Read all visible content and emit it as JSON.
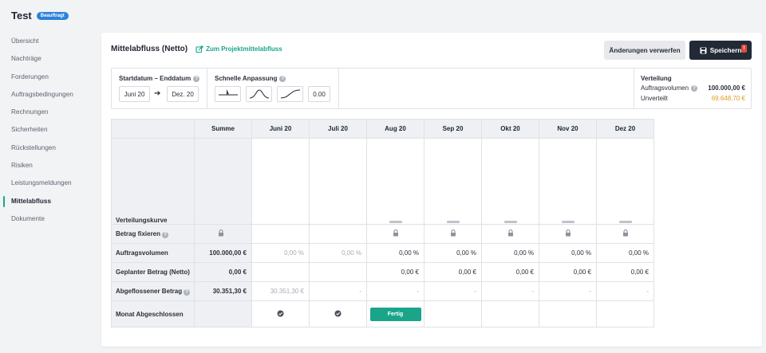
{
  "app": {
    "title": "Test",
    "badge": "Beauftragt"
  },
  "sidebar": {
    "items": [
      {
        "label": "Übersicht",
        "active": false
      },
      {
        "label": "Nachträge",
        "active": false
      },
      {
        "label": "Forderungen",
        "active": false
      },
      {
        "label": "Auftragsbedingungen",
        "active": false
      },
      {
        "label": "Rechnungen",
        "active": false
      },
      {
        "label": "Sicherheiten",
        "active": false
      },
      {
        "label": "Rückstellungen",
        "active": false
      },
      {
        "label": "Risiken",
        "active": false
      },
      {
        "label": "Leistungsmeldungen",
        "active": false
      },
      {
        "label": "Mittelabfluss",
        "active": true
      },
      {
        "label": "Dokumente",
        "active": false
      }
    ]
  },
  "header": {
    "title": "Mittelabfluss (Netto)",
    "link_label": "Zum Projektmittelabfluss",
    "discard_label": "Änderungen verwerfen",
    "save_label": "Speichern",
    "save_badge": "!"
  },
  "filters": {
    "date_range_label": "Startdatum – Enddatum",
    "start_date": "Juni 20",
    "end_date": "Dez. 20",
    "quick_adjust_label": "Schnelle Anpassung",
    "quick_value": "0.00",
    "curve_options": [
      "flat-curve-icon",
      "bell-curve-icon",
      "s-curve-icon"
    ]
  },
  "distribution": {
    "title": "Verteilung",
    "volume_label": "Auftragsvolumen",
    "volume_value": "100.000,00 €",
    "unassigned_label": "Unverteilt",
    "unassigned_value": "69.648,70 €",
    "unassigned_color": "#e09a1b"
  },
  "table": {
    "corner": "",
    "sum_header": "Summe",
    "months": [
      "Juni 20",
      "Juli 20",
      "Aug 20",
      "Sep 20",
      "Okt 20",
      "Nov 20",
      "Dez 20"
    ],
    "rows": {
      "curve": {
        "label": "Verteilungskurve",
        "bars": [
          false,
          false,
          true,
          true,
          true,
          true,
          true
        ]
      },
      "fix": {
        "label": "Betrag fixieren",
        "sum_lock": true,
        "locks": [
          false,
          false,
          true,
          true,
          true,
          true,
          true
        ]
      },
      "volume": {
        "label": "Auftragsvolumen",
        "sum": "100.000,00 €",
        "values": [
          "0,00 %",
          "0,00 %",
          "0,00 %",
          "0,00 %",
          "0,00 %",
          "0,00 %",
          "0,00 %"
        ],
        "muted": [
          true,
          true,
          false,
          false,
          false,
          false,
          false
        ]
      },
      "planned": {
        "label": "Geplanter Betrag (Netto)",
        "sum": "0,00 €",
        "values": [
          "",
          "",
          "0,00 €",
          "0,00 €",
          "0,00 €",
          "0,00 €",
          "0,00 €"
        ]
      },
      "outflow": {
        "label": "Abgeflossener Betrag",
        "sum": "30.351,30 €",
        "values": [
          "30.351,30 €",
          "-",
          "-",
          "-",
          "-",
          "-",
          "-"
        ]
      },
      "closed": {
        "label": "Monat Abgeschlossen",
        "done_label": "Fertig",
        "status": [
          "check",
          "check",
          "button",
          "",
          "",
          "",
          ""
        ]
      }
    }
  }
}
